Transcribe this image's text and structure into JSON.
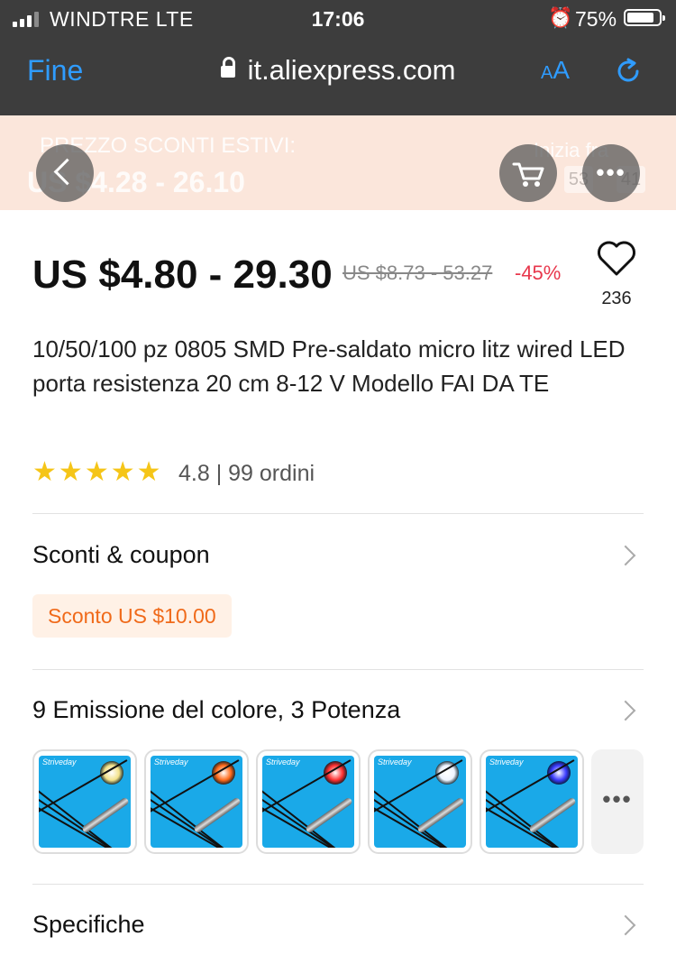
{
  "status_bar": {
    "carrier": "WINDTRE  LTE",
    "time": "17:06",
    "battery": "75%",
    "battery_level": 0.75
  },
  "browser": {
    "done": "Fine",
    "url": "it.aliexpress.com",
    "text_size": "AA"
  },
  "banner": {
    "promo": "PREZZO SCONTI ESTIVI:",
    "range": "US $4.28 - 26.10",
    "starts": "Inizia fra",
    "countdown": [
      "53",
      "41"
    ]
  },
  "product": {
    "price": "US $4.80 - 29.30",
    "original_price": "US $8.73 - 53.27",
    "discount": "-45%",
    "wishlist_count": "236",
    "title": "10/50/100 pz 0805 SMD Pre-saldato micro litz wired LED porta resistenza 20 cm 8-12 V Modello FAI DA TE",
    "rating_stars": 5,
    "rating_text": "4.8 | 99 ordini"
  },
  "coupons": {
    "label": "Sconti & coupon",
    "coupon": "Sconto US $10.00"
  },
  "variants": {
    "label": "9 Emissione del colore, 3 Potenza",
    "brand": "Striveday",
    "thumbs": [
      {
        "led_color": "#f3e28a"
      },
      {
        "led_color": "#ff6a1a"
      },
      {
        "led_color": "#ff3030"
      },
      {
        "led_color": "#eef4ff"
      },
      {
        "led_color": "#3a3aff"
      }
    ],
    "more": "•••"
  },
  "specs": {
    "label": "Specifiche"
  }
}
